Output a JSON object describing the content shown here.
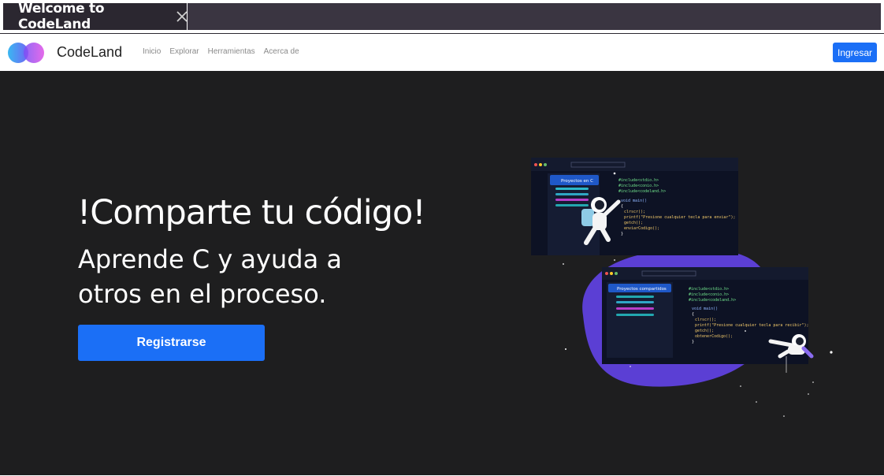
{
  "browser": {
    "tab_title": "Welcome to CodeLand",
    "close_icon": "close-icon"
  },
  "navbar": {
    "brand": "CodeLand",
    "links": [
      "Inicio",
      "Explorar",
      "Herramientas",
      "Acerca de"
    ],
    "login_label": "Ingresar",
    "accent": "#1b6ff6"
  },
  "hero": {
    "title": "!Comparte tu código!",
    "subtitle": "Aprende C y ayuda a otros en el proceso.",
    "register_label": "Registrarse",
    "background": "#1e1e1f"
  },
  "illustration": {
    "window1": {
      "sidebar_title": "Proyectos en C",
      "code": [
        "#include<stdio.h>",
        "#include<conio.h>",
        "#include<codeland.h>",
        "void main()",
        "{",
        "clrscr();",
        "printf(\"Presione cualquier tecla para enviar\");",
        "getch();",
        "enviarCodigo();",
        "}"
      ]
    },
    "window2": {
      "sidebar_title": "Proyectos compartidos",
      "code": [
        "#include<stdio.h>",
        "#include<conio.h>",
        "#include<codeland.h>",
        "void main()",
        "{",
        "clrscr();",
        "printf(\"Presione cualquier tecla para recibir\");",
        "getch();",
        "obtenerCodigo();",
        "}"
      ]
    },
    "blob_color": "#5b3fd4"
  }
}
